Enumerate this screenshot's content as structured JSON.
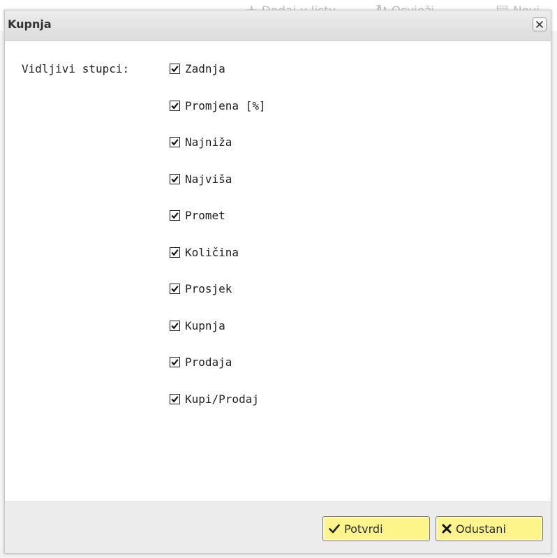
{
  "background_toolbar": {
    "add_to_list_label": "Dodaj u listu",
    "refresh_label": "Osvježi",
    "new_label": "Novi"
  },
  "dialog": {
    "title": "Kupnja",
    "close_icon": "close-x",
    "field_label": "Vidljivi stupci:",
    "columns": [
      {
        "label": "Zadnja",
        "checked": true
      },
      {
        "label": "Promjena [%]",
        "checked": true
      },
      {
        "label": "Najniža",
        "checked": true
      },
      {
        "label": "Najviša",
        "checked": true
      },
      {
        "label": "Promet",
        "checked": true
      },
      {
        "label": "Količina",
        "checked": true
      },
      {
        "label": "Prosjek",
        "checked": true
      },
      {
        "label": "Kupnja",
        "checked": true
      },
      {
        "label": "Prodaja",
        "checked": true
      },
      {
        "label": "Kupi/Prodaj",
        "checked": true
      }
    ],
    "confirm_label": "Potvrdi",
    "cancel_label": "Odustani"
  },
  "colors": {
    "button_yellow": "#fdf589",
    "footer_gray": "#ececec",
    "header_gray": "#dcdcdc"
  }
}
